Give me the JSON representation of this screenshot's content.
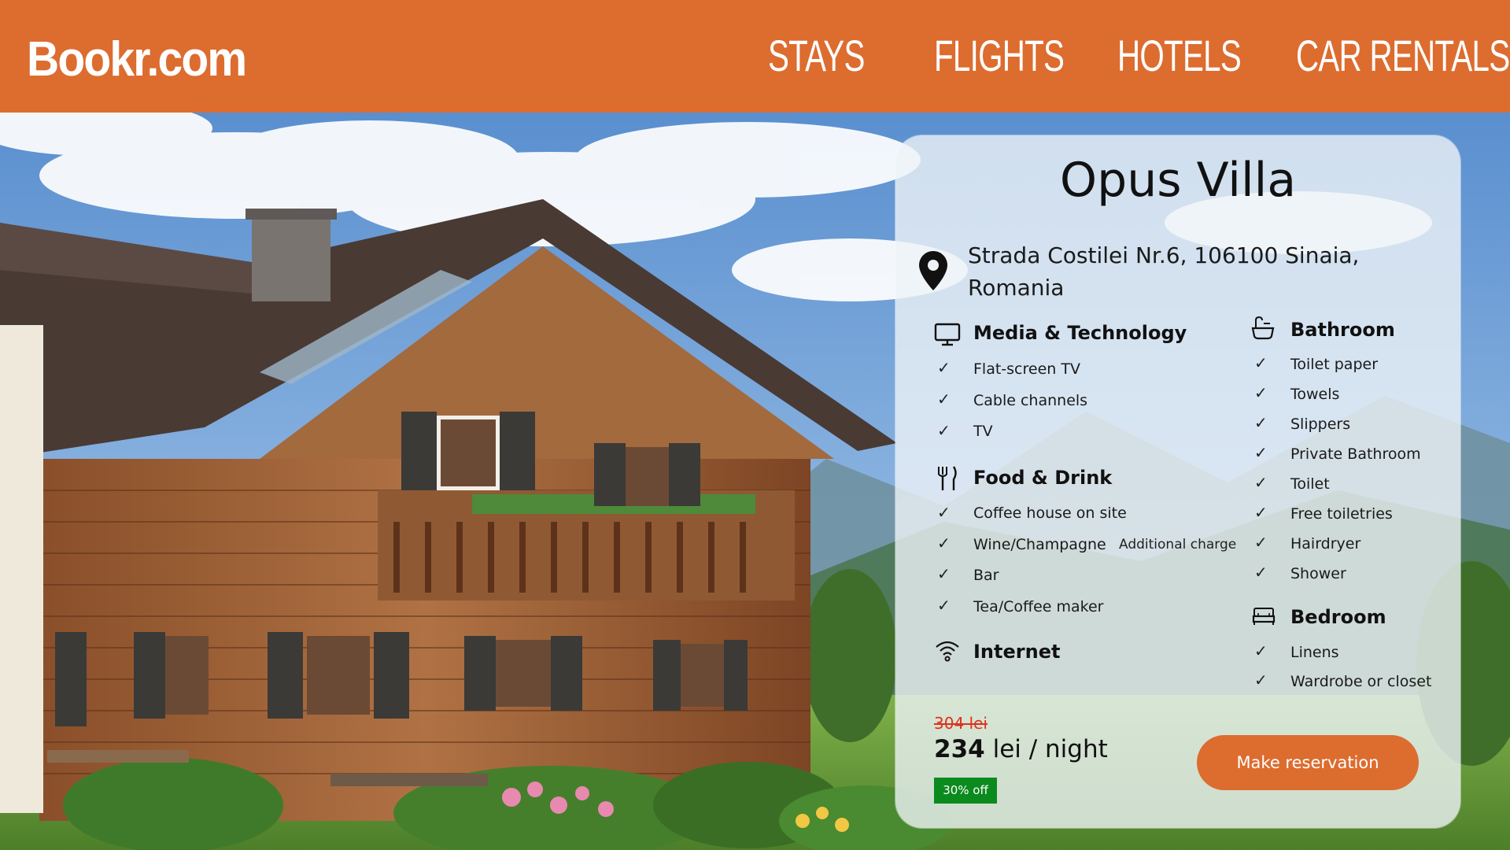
{
  "header": {
    "logo": "Bookr.com",
    "nav": [
      "STAYS",
      "FLIGHTS",
      "HOTELS",
      "CAR RENTALS"
    ]
  },
  "listing": {
    "title": "Opus Villa",
    "address_line1": "Strada Costilei Nr.6, 106100 Sinaia,",
    "address_line2": "Romania",
    "categories": {
      "media": {
        "title": "Media & Technology",
        "icon": "tv-icon",
        "items": [
          "Flat-screen TV",
          "Cable channels",
          "TV"
        ]
      },
      "food": {
        "title": "Food & Drink",
        "icon": "fork-knife-icon",
        "items": [
          "Coffee house on site",
          "Wine/Champagne",
          "Bar",
          "Tea/Coffee maker"
        ],
        "wine_note": "Additional charge"
      },
      "internet": {
        "title": "Internet",
        "icon": "wifi-icon"
      },
      "bathroom": {
        "title": "Bathroom",
        "icon": "bathtub-icon",
        "items": [
          "Toilet paper",
          "Towels",
          "Slippers",
          "Private Bathroom",
          "Toilet",
          "Free toiletries",
          "Hairdryer",
          "Shower"
        ]
      },
      "bedroom": {
        "title": "Bedroom",
        "icon": "bed-icon",
        "items": [
          "Linens",
          "Wardrobe or closet"
        ]
      }
    },
    "check_mark": "✓",
    "old_price": "304 lei",
    "price_amount": "234",
    "price_unit": "lei / night",
    "discount": "30% off",
    "reserve_button": "Make reservation"
  },
  "colors": {
    "brand": "#dd6c2f",
    "discount": "#0b8a1e",
    "old_price": "#e0301e"
  }
}
